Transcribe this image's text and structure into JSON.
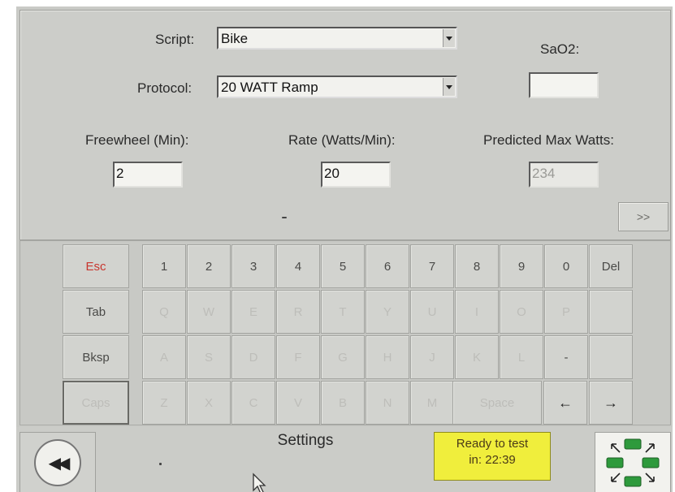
{
  "form": {
    "script_label": "Script:",
    "script_value": "Bike",
    "protocol_label": "Protocol:",
    "protocol_value": "20 WATT Ramp",
    "sao2_label": "SaO2:",
    "sao2_value": "",
    "freewheel_label": "Freewheel (Min):",
    "freewheel_value": "2",
    "rate_label": "Rate (Watts/Min):",
    "rate_value": "20",
    "predicted_label": "Predicted Max Watts:",
    "predicted_value": "234",
    "next_label": ">>"
  },
  "keyboard": {
    "esc": "Esc",
    "tab": "Tab",
    "bksp": "Bksp",
    "caps": "Caps",
    "row1": [
      "1",
      "2",
      "3",
      "4",
      "5",
      "6",
      "7",
      "8",
      "9",
      "0",
      "Del"
    ],
    "row2": [
      "Q",
      "W",
      "E",
      "R",
      "T",
      "Y",
      "U",
      "I",
      "O",
      "P",
      ""
    ],
    "row3": [
      "A",
      "S",
      "D",
      "F",
      "G",
      "H",
      "J",
      "K",
      "L",
      "-",
      ""
    ],
    "row4": [
      "Z",
      "X",
      "C",
      "V",
      "B",
      "N",
      "M"
    ],
    "space": "Space",
    "left_arrow": "←",
    "right_arrow": "→"
  },
  "bottom": {
    "back_icon": "rewind-icon",
    "back_glyph": "◀◀",
    "title": "Settings",
    "status_line1": "Ready to test",
    "status_line2": "in: 22:39",
    "fullscreen_icon": "expand-arrows-icon"
  },
  "colors": {
    "status_bg": "#f0ee3c",
    "esc_text": "#c8362f",
    "fullscreen_green": "#2e9a3c"
  }
}
